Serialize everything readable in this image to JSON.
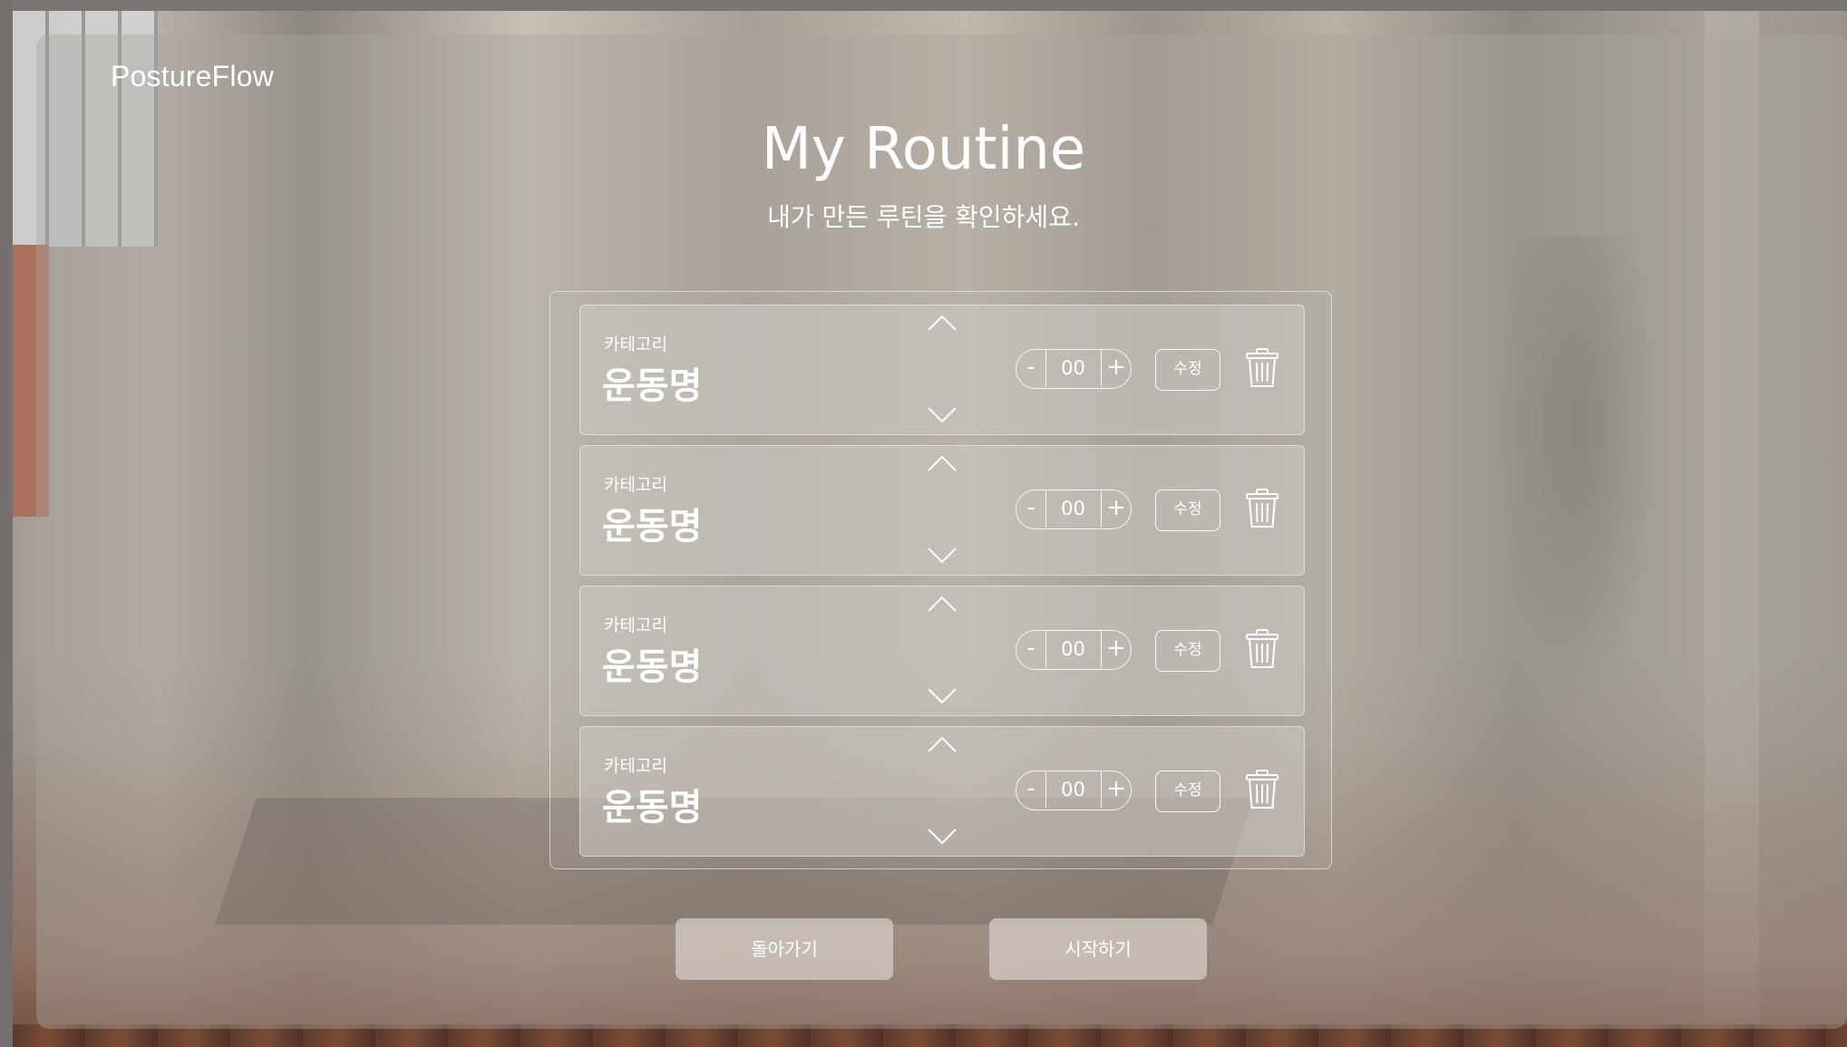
{
  "header": {
    "brand": "PostureFlow"
  },
  "main": {
    "title": "My Routine",
    "subtitle": "내가 만든 루틴을 확인하세요."
  },
  "routine": {
    "items": [
      {
        "category": "카테고리",
        "name": "운동명",
        "count": "00",
        "edit_label": "수정"
      },
      {
        "category": "카테고리",
        "name": "운동명",
        "count": "00",
        "edit_label": "수정"
      },
      {
        "category": "카테고리",
        "name": "운동명",
        "count": "00",
        "edit_label": "수정"
      },
      {
        "category": "카테고리",
        "name": "운동명",
        "count": "00",
        "edit_label": "수정"
      }
    ],
    "decrement_symbol": "-",
    "increment_symbol": "+",
    "icons": {
      "move_up": "chevron-up-icon",
      "move_down": "chevron-down-icon",
      "delete": "trash-icon"
    }
  },
  "footer": {
    "back_label": "돌아가기",
    "start_label": "시작하기"
  },
  "colors": {
    "text": "#ffffff",
    "panel": "#aaa49e"
  }
}
